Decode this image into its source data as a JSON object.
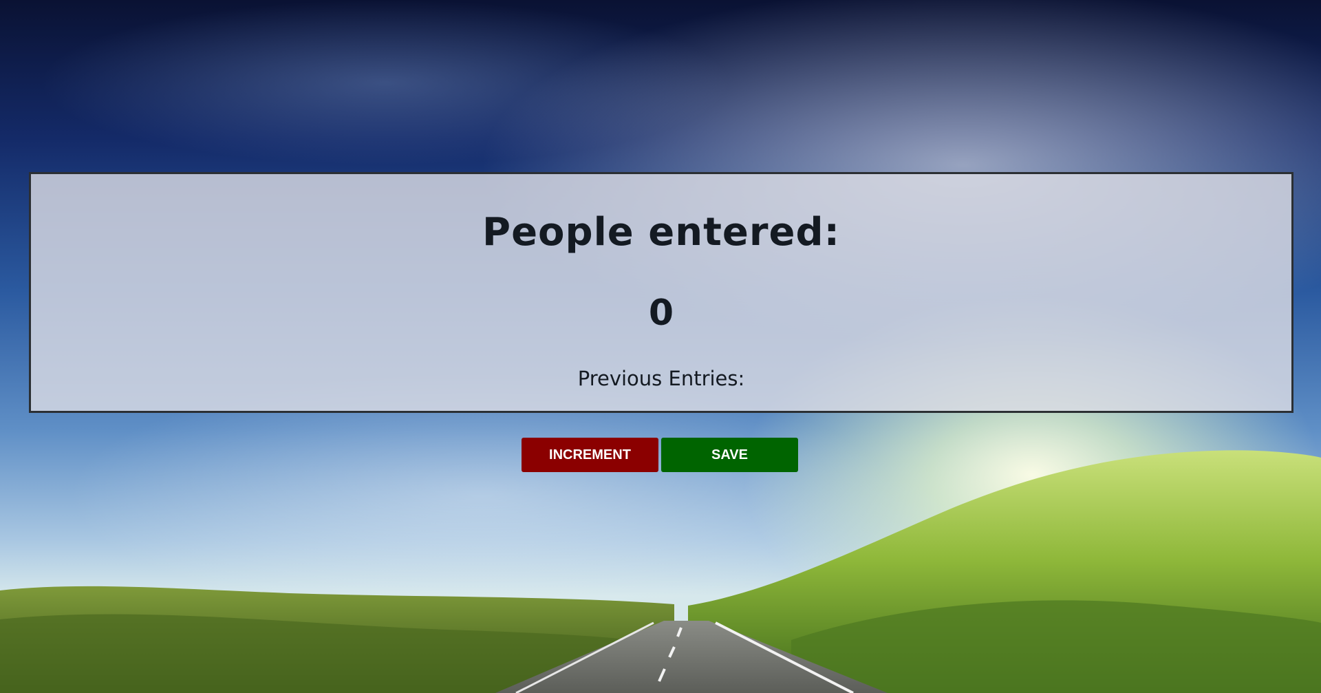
{
  "panel": {
    "title": "People entered:",
    "count": "0",
    "previous_label": "Previous Entries:"
  },
  "buttons": {
    "increment_label": "INCREMENT",
    "save_label": "SAVE"
  },
  "colors": {
    "increment_button": "#8b0000",
    "save_button": "#006400",
    "panel_text": "#141a22",
    "panel_border": "#2b2f33"
  }
}
